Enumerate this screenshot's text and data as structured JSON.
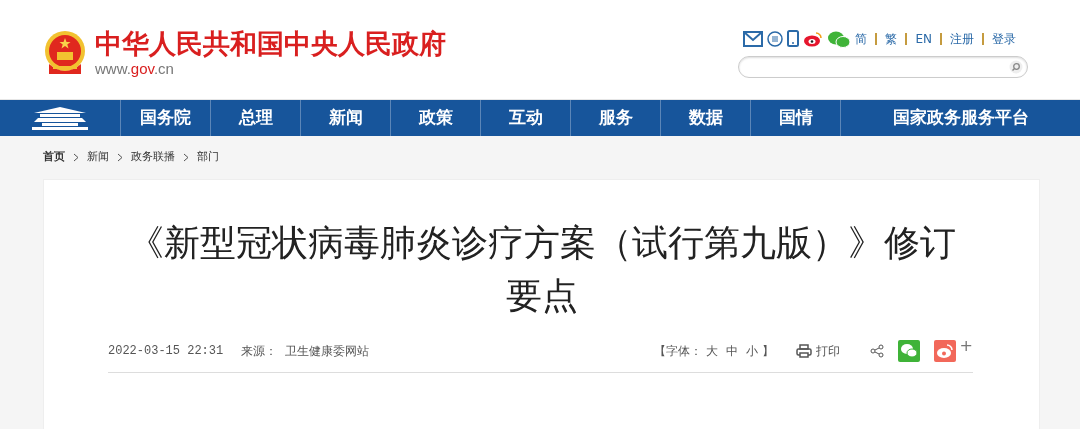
{
  "site": {
    "title": "中华人民共和国中央人民政府",
    "url": {
      "prefix": "www.",
      "domain": "gov",
      "suffix": ".cn"
    }
  },
  "top_links": [
    "简",
    "繁",
    "EN",
    "注册",
    "登录"
  ],
  "nav": [
    "国务院",
    "总理",
    "新闻",
    "政策",
    "互动",
    "服务",
    "数据",
    "国情",
    "国家政务服务平台"
  ],
  "breadcrumb": [
    {
      "label": "首页",
      "bold": true
    },
    {
      "label": "新闻",
      "bold": false
    },
    {
      "label": "政务联播",
      "bold": false
    },
    {
      "label": "部门",
      "bold": false
    }
  ],
  "article": {
    "title": "《新型冠状病毒肺炎诊疗方案（试行第九版）》修订要点",
    "date": "2022-03-15 22:31",
    "source_label": "来源：",
    "source": "卫生健康委网站",
    "font_size": {
      "open": "【字体：",
      "sizes": [
        "大",
        "中",
        "小"
      ],
      "close": "】"
    },
    "print": "打印",
    "more": "+"
  }
}
